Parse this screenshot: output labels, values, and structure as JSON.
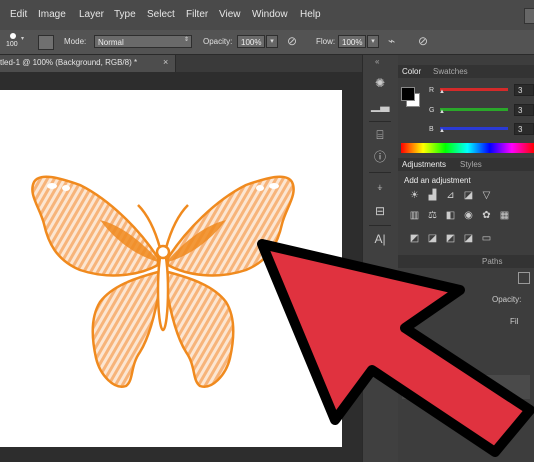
{
  "menu": [
    "Edit",
    "Image",
    "Layer",
    "Type",
    "Select",
    "Filter",
    "View",
    "Window",
    "Help"
  ],
  "options": {
    "brush_size": "100",
    "mode_label": "Mode:",
    "mode_value": "Normal",
    "opacity_label": "Opacity:",
    "opacity_value": "100%",
    "flow_label": "Flow:",
    "flow_value": "100%"
  },
  "document_tab": {
    "title": "tled-1 @ 100% (Background, RGB/8) *",
    "close": "×"
  },
  "color_panel": {
    "tabs": [
      "Color",
      "Swatches"
    ],
    "channels": [
      {
        "label": "R",
        "value": "3",
        "color": "#d42a2a"
      },
      {
        "label": "G",
        "value": "3",
        "color": "#2aa82a"
      },
      {
        "label": "B",
        "value": "3",
        "color": "#2a3ad4"
      }
    ]
  },
  "adjustments_panel": {
    "tabs": [
      "Adjustments",
      "Styles"
    ],
    "heading": "Add an adjustment"
  },
  "layers_panel": {
    "tabs": [
      "Paths"
    ],
    "opacity_label": "Opacity:",
    "fill_label": "Fil"
  },
  "collapse_icon": "«",
  "colors": {
    "arrow": "#e0323f",
    "butterfly": "#f08a1e",
    "butterfly_light": "#f7b47a"
  }
}
